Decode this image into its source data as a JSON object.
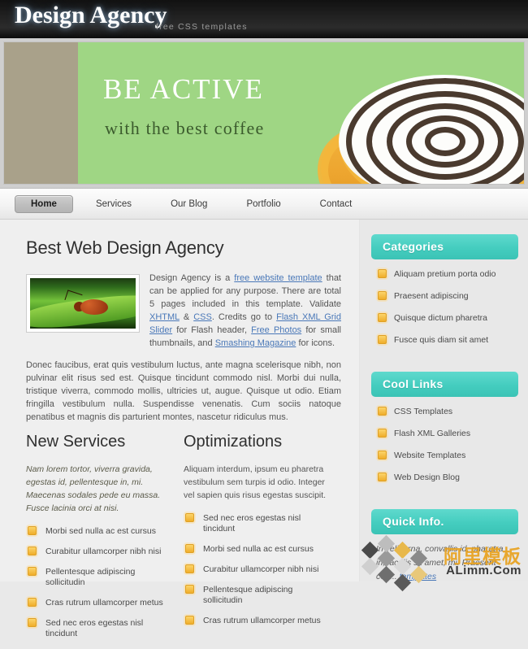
{
  "header": {
    "logo": "Design Agency",
    "tagline": "free CSS templates"
  },
  "banner": {
    "title": "BE ACTIVE",
    "subtitle": "with the best coffee",
    "image_alt": "coffee-cup"
  },
  "nav": {
    "items": [
      {
        "label": "Home",
        "active": true
      },
      {
        "label": "Services",
        "active": false
      },
      {
        "label": "Our Blog",
        "active": false
      },
      {
        "label": "Portfolio",
        "active": false
      },
      {
        "label": "Contact",
        "active": false
      }
    ]
  },
  "main": {
    "title": "Best Web Design Agency",
    "intro_html": "Design Agency is a <a href=\"#\">free website template</a> that can be applied for any purpose. There are total 5 pages included in this template. Validate <a href=\"#\">XHTML</a> &amp; <a href=\"#\">CSS</a>. Credits go to <a href=\"#\">Flash XML Grid Slider</a> for Flash header, <a href=\"#\">Free Photos</a> for small thumbnails, and <a href=\"#\">Smashing Magazine</a> for icons.",
    "paragraph2": "Donec faucibus, erat quis vestibulum luctus, ante magna scelerisque nibh, non pulvinar elit risus sed est. Quisque tincidunt commodo nisl. Morbi dui nulla, tristique viverra, commodo mollis, ultricies ut, augue. Quisque ut odio. Etiam fringilla vestibulum nulla. Suspendisse venenatis. Cum sociis natoque penatibus et magnis dis parturient montes, nascetur ridiculus mus.",
    "columns": [
      {
        "title": "New Services",
        "lead": "Nam lorem tortor, viverra gravida, egestas id, pellentesque in, mi. Maecenas sodales pede eu massa. Fusce lacinia orci at nisi.",
        "lead_italic": true,
        "items": [
          "Morbi sed nulla ac est cursus",
          "Curabitur ullamcorper nibh nisi",
          "Pellentesque adipiscing sollicitudin",
          "Cras rutrum ullamcorper metus",
          "Sed nec eros egestas nisl tincidunt"
        ]
      },
      {
        "title": "Optimizations",
        "lead": "Aliquam interdum, ipsum eu pharetra vestibulum sem turpis id odio. Integer vel sapien quis risus egestas suscipit.",
        "lead_italic": false,
        "items": [
          "Sed nec eros egestas nisl tincidunt",
          "Morbi sed nulla ac est cursus",
          "Curabitur ullamcorper nibh nisi",
          "Pellentesque adipiscing sollicitudin",
          "Cras rutrum ullamcorper metus"
        ]
      }
    ]
  },
  "sidebar": {
    "widgets": [
      {
        "title": "Categories",
        "items": [
          "Aliquam pretium porta odio",
          "Praesent adipiscing",
          "Quisque dictum pharetra",
          "Fusce quis diam sit amet"
        ]
      },
      {
        "title": "Cool Links",
        "items": [
          "CSS Templates",
          "Flash XML Galleries",
          "Website Templates",
          "Web Design Blog"
        ]
      }
    ],
    "quick_info": {
      "title": "Quick Info.",
      "text_html": "In velit urna, convallis id, pharetra in, iaculis sit amet, mi. Praesent con... <a href=\"#\">templates</a>"
    }
  },
  "watermark": {
    "chinese": "阿里模板",
    "latin": "ALimm.Com"
  },
  "colors": {
    "accent_teal": "#44cdbf",
    "bullet_orange": "#efae2b",
    "banner_green": "#9fd684",
    "banner_tan": "#a9a18a",
    "link_blue": "#4a78b8",
    "topbar_black": "#1a1a1a"
  }
}
